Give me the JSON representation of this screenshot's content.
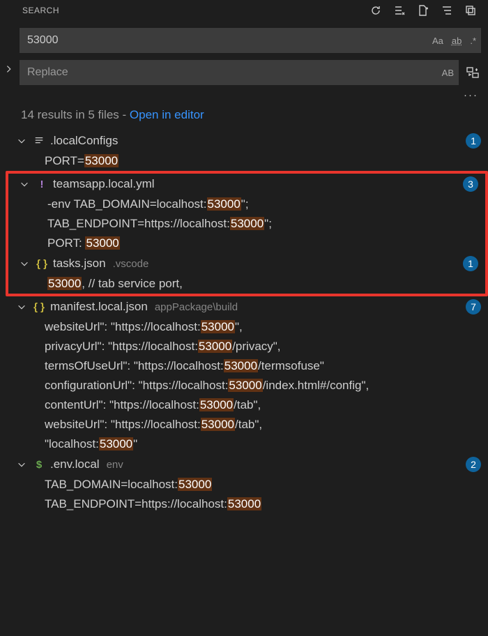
{
  "header": {
    "title": "SEARCH"
  },
  "search": {
    "value": "53000",
    "replace_placeholder": "Replace",
    "case_label": "Aa",
    "word_label": "ab",
    "regex_label": ".*",
    "preserve_label": "AB"
  },
  "summary": {
    "text": "14 results in 5 files - ",
    "link": "Open in editor"
  },
  "files": [
    {
      "icon": "lines",
      "name": ".localConfigs",
      "path": "",
      "count": "1",
      "highlight": false,
      "results": [
        {
          "pre": "PORT=",
          "match": "53000",
          "post": ""
        }
      ]
    },
    {
      "icon": "yaml",
      "name": "teamsapp.local.yml",
      "path": "",
      "count": "3",
      "highlight": true,
      "results": [
        {
          "pre": "-env TAB_DOMAIN=localhost:",
          "match": "53000",
          "post": "\";"
        },
        {
          "pre": "TAB_ENDPOINT=https://localhost:",
          "match": "53000",
          "post": "\";"
        },
        {
          "pre": "PORT: ",
          "match": "53000",
          "post": ""
        }
      ]
    },
    {
      "icon": "json",
      "name": "tasks.json",
      "path": ".vscode",
      "count": "1",
      "highlight": true,
      "results": [
        {
          "pre": "",
          "match": "53000",
          "post": ", // tab service port,"
        }
      ]
    },
    {
      "icon": "json",
      "name": "manifest.local.json",
      "path": "appPackage\\build",
      "count": "7",
      "highlight": false,
      "results": [
        {
          "pre": "websiteUrl\": \"https://localhost:",
          "match": "53000",
          "post": "\","
        },
        {
          "pre": "privacyUrl\": \"https://localhost:",
          "match": "53000",
          "post": "/privacy\","
        },
        {
          "pre": "termsOfUseUrl\": \"https://localhost:",
          "match": "53000",
          "post": "/termsofuse\""
        },
        {
          "pre": "configurationUrl\": \"https://localhost:",
          "match": "53000",
          "post": "/index.html#/config\","
        },
        {
          "pre": "contentUrl\": \"https://localhost:",
          "match": "53000",
          "post": "/tab\","
        },
        {
          "pre": "websiteUrl\": \"https://localhost:",
          "match": "53000",
          "post": "/tab\","
        },
        {
          "pre": "\"localhost:",
          "match": "53000",
          "post": "\""
        }
      ]
    },
    {
      "icon": "env",
      "name": ".env.local",
      "path": "env",
      "count": "2",
      "highlight": false,
      "results": [
        {
          "pre": "TAB_DOMAIN=localhost:",
          "match": "53000",
          "post": ""
        },
        {
          "pre": "TAB_ENDPOINT=https://localhost:",
          "match": "53000",
          "post": ""
        }
      ]
    }
  ]
}
